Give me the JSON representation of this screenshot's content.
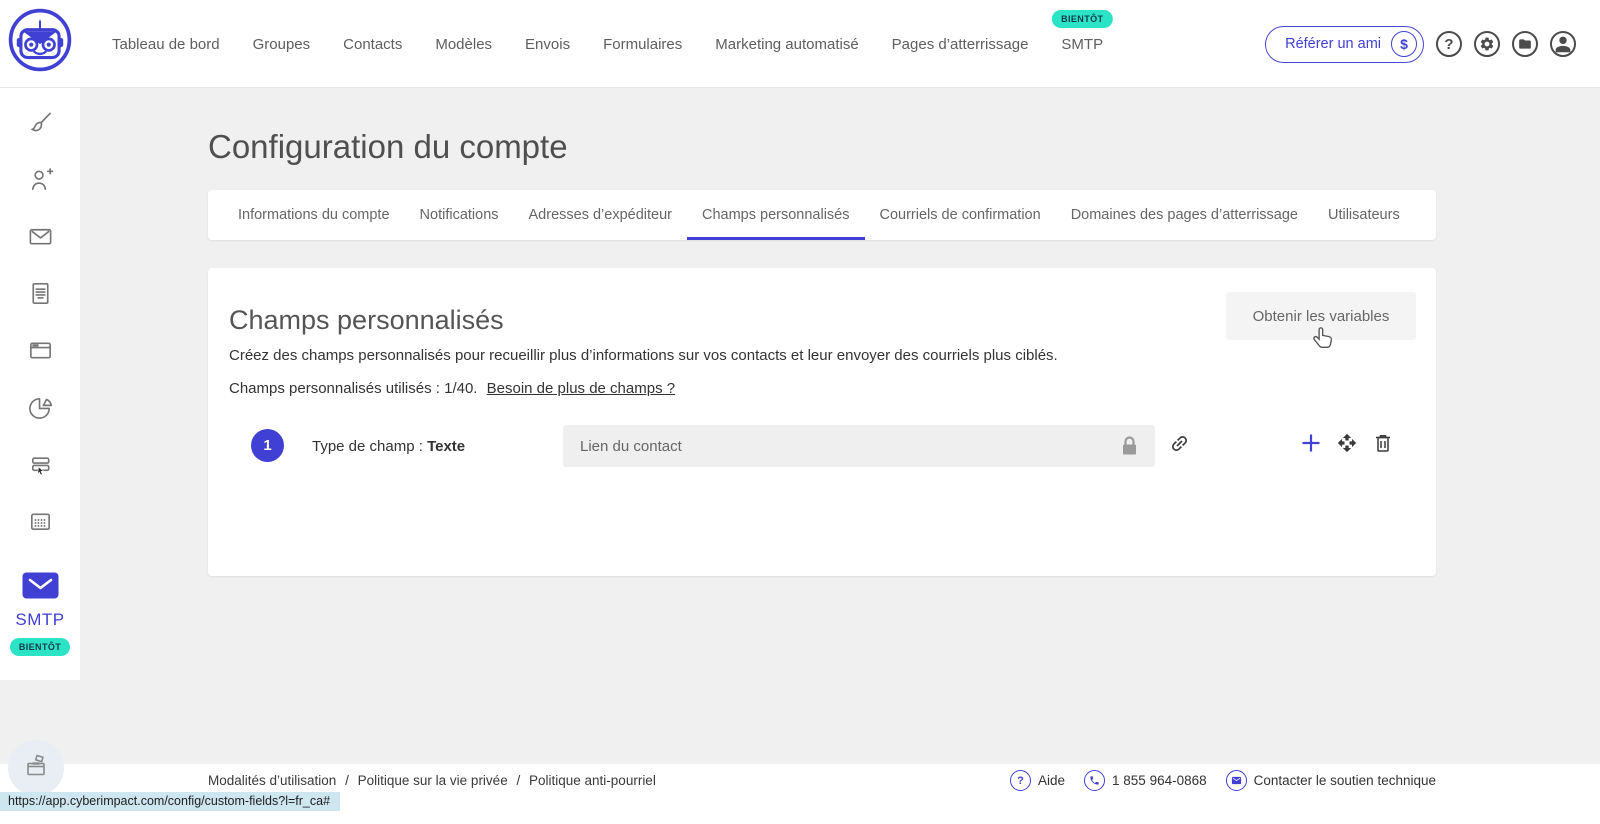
{
  "colors": {
    "accent": "#4040D4",
    "teal": "#2BE3C5",
    "statusbar_bg": "#CDE6F0"
  },
  "glyphs": {
    "question": "?",
    "dollar": "$"
  },
  "header": {
    "nav": [
      "Tableau de bord",
      "Groupes",
      "Contacts",
      "Modèles",
      "Envois",
      "Formulaires",
      "Marketing automatisé",
      "Pages d’atterrissage",
      "SMTP"
    ],
    "smtp_badge": "BIENTÔT",
    "refer_button": "Référer un ami"
  },
  "sidebar": {
    "icons": [
      "brush",
      "person-add",
      "envelope",
      "document",
      "browser-window",
      "pie-chart",
      "form-cursor",
      "calendar"
    ],
    "smtp_label": "SMTP",
    "smtp_badge": "BIENTÔT"
  },
  "page": {
    "title": "Configuration du compte",
    "tabs": [
      "Informations du compte",
      "Notifications",
      "Adresses d’expéditeur",
      "Champs personnalisés",
      "Courriels de confirmation",
      "Domaines des pages d’atterrissage",
      "Utilisateurs"
    ],
    "active_tab": "Champs personnalisés",
    "card": {
      "heading": "Champs personnalisés",
      "description": "Créez des champs personnalisés pour recueillir plus d’informations sur vos contacts et leur envoyer des courriels plus ciblés.",
      "usage_text": "Champs personnalisés utilisés : 1/40.",
      "usage_link": "Besoin de plus de champs ?",
      "get_variables_button": "Obtenir les variables",
      "field": {
        "index": "1",
        "type_label": "Type de champ : ",
        "type_value": "Texte",
        "name": "Lien du contact"
      }
    }
  },
  "footer": {
    "links": [
      "Modalités d’utilisation",
      "Politique sur la vie privée",
      "Politique anti-pourriel"
    ],
    "separator": "/",
    "help_label": "Aide",
    "phone": "1 855 964-0868",
    "support_label": "Contacter le soutien technique"
  },
  "statusbar": {
    "url": "https://app.cyberimpact.com/config/custom-fields?l=fr_ca#"
  }
}
